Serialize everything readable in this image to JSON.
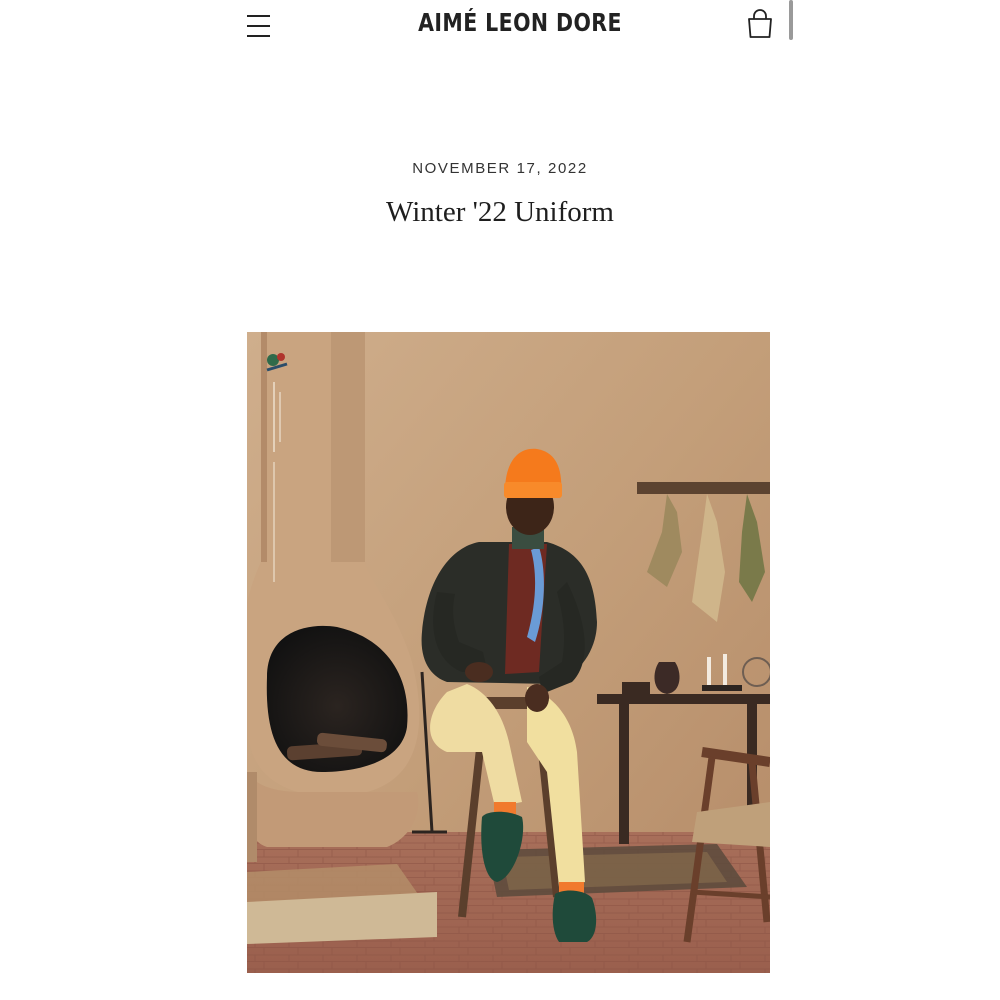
{
  "header": {
    "brand": "AIMÉ LEON DORE",
    "menu_icon": "hamburger-menu-icon",
    "cart_icon": "shopping-bag-icon"
  },
  "post": {
    "date": "NOVEMBER 17, 2022",
    "title": "Winter '22 Uniform"
  },
  "colors": {
    "text": "#1a1a1a",
    "background": "#ffffff",
    "beanie": "#f57a1c",
    "wall": "#c5a27e"
  }
}
